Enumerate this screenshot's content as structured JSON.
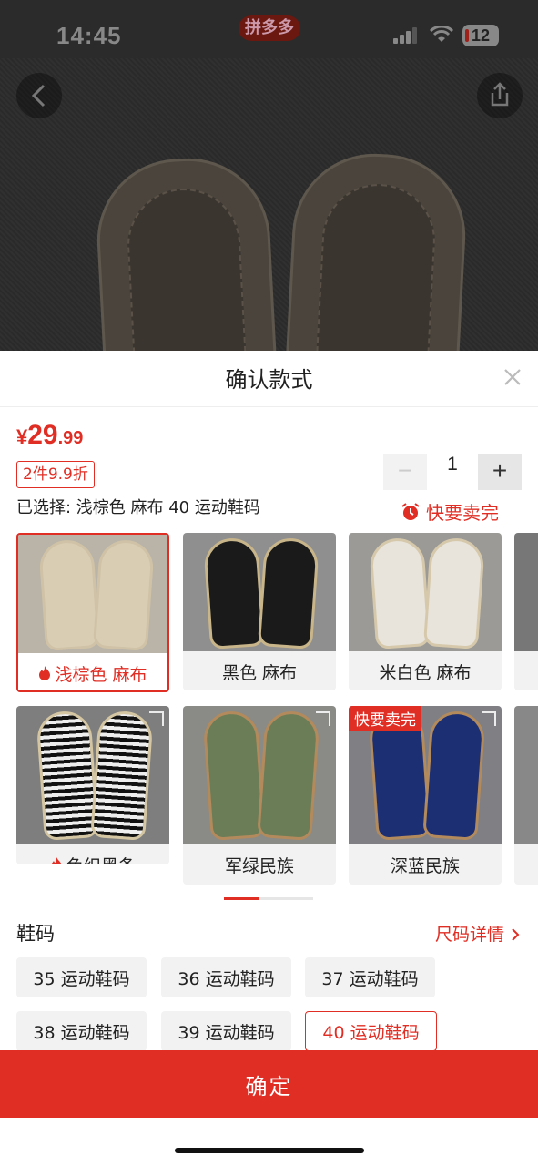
{
  "status_bar": {
    "time": "14:45",
    "app_badge": "拼多多",
    "battery": "12"
  },
  "sheet": {
    "title": "确认款式",
    "price": {
      "currency": "¥",
      "integer": "29",
      "decimal": ".99"
    },
    "promo": "2件9.9折",
    "selected": "已选择: 浅棕色 麻布 40 运动鞋码",
    "quantity": {
      "minus": "−",
      "value": "1",
      "plus": "+"
    },
    "hot_label": "快要卖完",
    "variants": [
      {
        "label": "浅棕色 麻布",
        "hot": true,
        "selected": true
      },
      {
        "label": "黑色 麻布",
        "hot": false,
        "selected": false
      },
      {
        "label": "米白色 麻布",
        "hot": false,
        "selected": false
      },
      {
        "label": "色织黑条",
        "hot": true,
        "selected": false
      },
      {
        "label": "军绿民族",
        "hot": false,
        "selected": false
      },
      {
        "label": "深蓝民族",
        "hot": false,
        "selected": false,
        "tag": "快要卖完"
      }
    ],
    "size_title": "鞋码",
    "size_detail": "尺码详情",
    "sizes": [
      "35 运动鞋码",
      "36 运动鞋码",
      "37 运动鞋码",
      "38 运动鞋码",
      "39 运动鞋码",
      "40 运动鞋码"
    ],
    "selected_size": "40 运动鞋码",
    "confirm": "确定"
  },
  "colors": {
    "accent": "#e02e24"
  },
  "icons": {
    "back": "chevron-left-icon",
    "share": "share-icon",
    "close": "close-icon",
    "alarm": "alarm-clock-icon",
    "flame": "flame-icon",
    "expand": "expand-icon",
    "chevron": "chevron-right-icon"
  }
}
